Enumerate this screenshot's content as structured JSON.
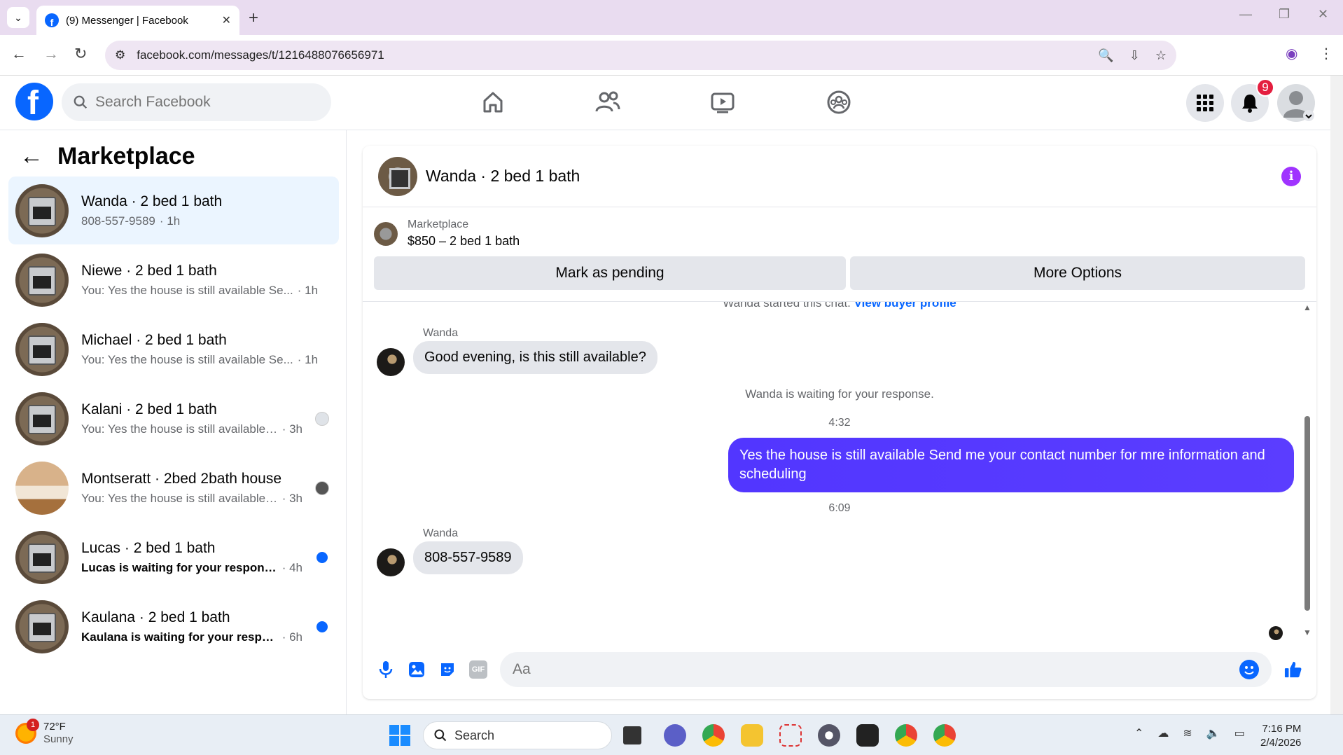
{
  "browser": {
    "tab_title": "(9) Messenger | Facebook",
    "new_tab": "+",
    "url": "facebook.com/messages/t/1216488076656971"
  },
  "facebook": {
    "logo": "f",
    "search_placeholder": "Search Facebook",
    "notifications_count": "9",
    "nav_icons": [
      "home-icon",
      "friends-icon",
      "watch-icon",
      "groups-icon"
    ]
  },
  "sidebar": {
    "title": "Marketplace",
    "conversations": [
      {
        "name": "Wanda · 2 bed 1 bath",
        "preview": "808-557-9589",
        "time": "· 1h",
        "unread": false,
        "active": true
      },
      {
        "name": "Niewe · 2 bed 1 bath",
        "preview": "You: Yes the house is still available Se...",
        "time": "· 1h",
        "unread": false
      },
      {
        "name": "Michael · 2 bed 1 bath",
        "preview": "You: Yes the house is still available Se...",
        "time": "· 1h",
        "unread": false
      },
      {
        "name": "Kalani · 2 bed 1 bath",
        "preview": "You: Yes the house is still available ...",
        "time": "· 3h",
        "unread": false
      },
      {
        "name": "Montseratt · 2bed 2bath house",
        "preview": "You: Yes the house is still available ...",
        "time": "· 3h",
        "unread": false
      },
      {
        "name": "Lucas · 2 bed 1 bath",
        "preview": "Lucas is waiting for your response.",
        "time": "· 4h",
        "unread": true
      },
      {
        "name": "Kaulana · 2 bed 1 bath",
        "preview": "Kaulana is waiting for your respon...",
        "time": "· 6h",
        "unread": true
      }
    ]
  },
  "chat": {
    "title": "Wanda · 2 bed 1 bath",
    "listing_label": "Marketplace",
    "listing_price": "$850 – 2 bed 1 bath",
    "mark_pending": "Mark as pending",
    "more_options": "More Options",
    "started_text": "Wanda started this chat.",
    "view_profile": "View buyer profile",
    "messages": {
      "sender1": "Wanda",
      "msg1": "Good evening, is this still available?",
      "waiting": "Wanda is waiting for your response.",
      "ts1": "4:32",
      "msg2": "Yes the house is still available  Send me your contact number for mre information and  scheduling",
      "ts2": "6:09",
      "sender2": "Wanda",
      "msg3": "808-557-9589"
    },
    "composer_placeholder": "Aa"
  },
  "taskbar": {
    "weather_badge": "1",
    "temperature": "72°F",
    "condition": "Sunny",
    "search": "Search",
    "time": "7:16 PM",
    "date": "2/4/2026"
  }
}
